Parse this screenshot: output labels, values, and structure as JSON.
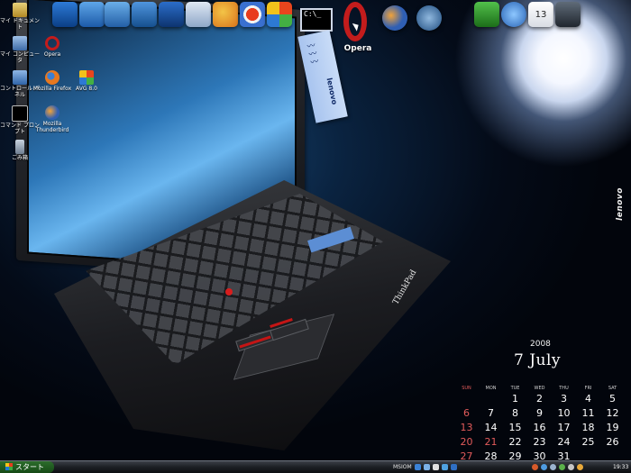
{
  "desktop": {
    "icons": [
      {
        "label": "マイ ドキュメント",
        "icon": "folder-icon"
      },
      {
        "label": "マイ コンピュータ",
        "icon": "computer-icon"
      },
      {
        "label": "Opera",
        "icon": "opera-icon"
      },
      {
        "label": "コントロール パネル",
        "icon": "control-panel-icon"
      },
      {
        "label": "Mozilla Firefox",
        "icon": "firefox-icon"
      },
      {
        "label": "AVG 8.0",
        "icon": "avg-icon"
      },
      {
        "label": "コマンド プロンプト",
        "icon": "command-prompt-icon"
      },
      {
        "label": "Mozilla Thunderbird",
        "icon": "thunderbird-icon"
      },
      {
        "label": "ごみ箱",
        "icon": "recycle-bin-icon"
      }
    ]
  },
  "dock": {
    "opera_label": "Opera",
    "cmd_prompt_text": "C:\\_"
  },
  "sticky_note": {
    "logo": "lenovo"
  },
  "wallpaper": {
    "laptop_logo": "ThinkPad",
    "side_logo": "lenovo"
  },
  "calendar": {
    "year": "2008",
    "title": "7 July",
    "weekdays": [
      "SUN",
      "MON",
      "TUE",
      "WED",
      "THU",
      "FRI",
      "SAT"
    ],
    "weeks": [
      [
        "",
        "",
        "1",
        "2",
        "3",
        "4",
        "5"
      ],
      [
        "6",
        "7",
        "8",
        "9",
        "10",
        "11",
        "12"
      ],
      [
        "13",
        "14",
        "15",
        "16",
        "17",
        "18",
        "19"
      ],
      [
        "20",
        "21",
        "22",
        "23",
        "24",
        "25",
        "26"
      ],
      [
        "27",
        "28",
        "29",
        "30",
        "31",
        "",
        ""
      ]
    ],
    "sunday_color": "#e35b5b"
  },
  "taskbar": {
    "start_label": "スタート",
    "language": "MSIOM",
    "clock": "19:33"
  }
}
